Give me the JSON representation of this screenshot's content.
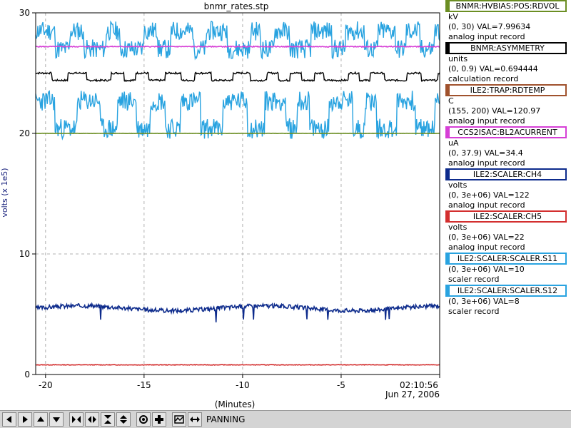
{
  "chart_data": {
    "type": "line",
    "title": "bnmr_rates.stp",
    "ylabel": "volts (x 1e5)",
    "xlabel": "(Minutes)",
    "xlim": [
      -20.5,
      0
    ],
    "ylim": [
      0,
      30
    ],
    "grid": true,
    "x_ticks": [
      -20,
      -15,
      -10,
      -5
    ],
    "x_tick_labels": [
      "-20",
      "-15",
      "-10",
      "-5"
    ],
    "end_time_label": "02:10:56",
    "end_date_label": "Jun 27, 2006",
    "y_ticks": [
      0,
      10,
      20,
      30
    ],
    "y_tick_labels": [
      "0",
      "10",
      "20",
      "30"
    ],
    "series": [
      {
        "color": "#29a3e0",
        "style": "band",
        "level_high": 28.5,
        "level_low": 27.0,
        "spread": 1.6,
        "seed": 11,
        "clip_top": 30
      },
      {
        "color": "#29a3e0",
        "style": "band",
        "level_high": 22.7,
        "level_low": 20.4,
        "spread": 1.7,
        "seed": 23
      },
      {
        "color": "#d63fd6",
        "style": "flat",
        "level": 27.2,
        "spread": 0.08,
        "seed": 5
      },
      {
        "color": "#000000",
        "style": "band",
        "level_high": 25.0,
        "level_low": 24.4,
        "spread": 0.15,
        "seed": 7
      },
      {
        "color": "#6b8e23",
        "style": "flat",
        "level": 20.0,
        "spread": 0.03,
        "seed": 9
      },
      {
        "color": "#0d2b8c",
        "style": "noisy",
        "level": 5.5,
        "spread": 0.35,
        "seed": 3
      },
      {
        "color": "#d32f2f",
        "style": "flat",
        "level": 0.8,
        "spread": 0.05,
        "seed": 13
      }
    ]
  },
  "legend": {
    "items": [
      {
        "name": "BNMR:HVBIAS:POS:RDVOL",
        "color": "#6b8e23",
        "lines": [
          "kV",
          "(0, 30) VAL=7.99634",
          "analog input record"
        ]
      },
      {
        "name": "BNMR:ASYMMETRY",
        "color": "#000000",
        "lines": [
          "units",
          "(0, 0.9) VAL=0.694444",
          "calculation record"
        ]
      },
      {
        "name": "ILE2:TRAP:RDTEMP",
        "color": "#a0522d",
        "lines": [
          "C",
          "(155, 200) VAL=120.97",
          "analog input record"
        ]
      },
      {
        "name": "CCS2ISAC:BL2ACURRENT",
        "color": "#d63fd6",
        "lines": [
          "uA",
          "(0, 37.9) VAL=34.4",
          "analog input record"
        ]
      },
      {
        "name": "ILE2:SCALER:CH4",
        "color": "#0d2b8c",
        "lines": [
          "volts",
          "(0, 3e+06) VAL=122",
          "analog input record"
        ]
      },
      {
        "name": "ILE2:SCALER:CH5",
        "color": "#d32f2f",
        "lines": [
          "volts",
          "(0, 3e+06) VAL=22",
          "analog input record"
        ]
      },
      {
        "name": "ILE2:SCALER:SCALER.S11",
        "color": "#29a3e0",
        "lines": [
          "(0, 3e+06) VAL=10",
          "scaler record"
        ]
      },
      {
        "name": "ILE2:SCALER:SCALER.S12",
        "color": "#29a3e0",
        "lines": [
          "(0, 3e+06) VAL=8",
          "scaler record"
        ]
      }
    ]
  },
  "toolbar": {
    "mode_label": "PANNING",
    "buttons": [
      {
        "icon": "arrow-left-icon"
      },
      {
        "icon": "arrow-right-icon"
      },
      {
        "icon": "arrow-up-icon"
      },
      {
        "icon": "arrow-down-icon"
      },
      {
        "icon": "zoom-x-in-icon"
      },
      {
        "icon": "zoom-x-out-icon"
      },
      {
        "icon": "zoom-y-in-icon"
      },
      {
        "icon": "zoom-y-out-icon"
      },
      {
        "icon": "stagger-icon"
      },
      {
        "icon": "add-icon"
      },
      {
        "icon": "zoom-mode-icon"
      },
      {
        "icon": "pan-mode-icon"
      }
    ]
  }
}
